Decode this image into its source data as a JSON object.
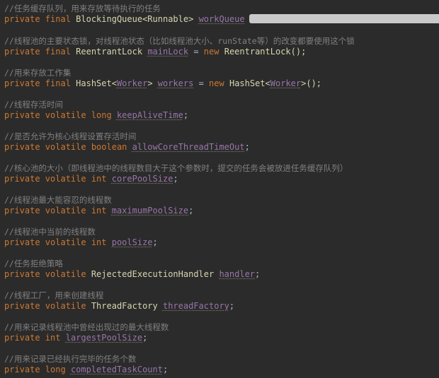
{
  "colors": {
    "background": "#2b2b2b",
    "comment": "#808080",
    "keyword": "#cc7832",
    "type": "#d6d6b0",
    "field": "#9876aa",
    "redaction": "#c9c9c9"
  },
  "blocks": [
    {
      "comment": "//任务缓存队列，用来存放等待执行的任务",
      "code": {
        "modifiers": "private final",
        "type": "BlockingQueue<Runnable>",
        "name": "workQueue",
        "tail": ""
      }
    },
    {
      "comment": "//线程池的主要状态锁，对线程池状态（比如线程池大小、runState等）的改变都要使用这个锁",
      "code": {
        "modifiers": "private final",
        "type": "ReentrantLock",
        "name": "mainLock",
        "eq": " = ",
        "new_kw": "new",
        "init": "ReentrantLock();"
      }
    },
    {
      "comment": "//用来存放工作集",
      "code": {
        "modifiers": "private final",
        "type_pre": "HashSet<",
        "type_generic": "Worker",
        "type_post": ">",
        "name": "workers",
        "eq": " = ",
        "new_kw": "new",
        "init_pre": "HashSet<",
        "init_generic": "Worker",
        "init_post": ">();"
      }
    },
    {
      "comment": "//线程存活时间",
      "code": {
        "modifiers": "private volatile long",
        "name": "keepAliveTime",
        "semi": ";"
      }
    },
    {
      "comment": "//是否允许为核心线程设置存活时间",
      "code": {
        "modifiers": "private volatile boolean",
        "name": "allowCoreThreadTimeOut",
        "semi": ";"
      }
    },
    {
      "comment": "//核心池的大小（即线程池中的线程数目大于这个参数时，提交的任务会被放进任务缓存队列）",
      "code": {
        "modifiers": "private volatile int",
        "name": "corePoolSize",
        "semi": ";"
      }
    },
    {
      "comment": "//线程池最大能容忍的线程数",
      "code": {
        "modifiers": "private volatile int",
        "name": "maximumPoolSize",
        "semi": ";"
      }
    },
    {
      "comment": "//线程池中当前的线程数",
      "code": {
        "modifiers": "private volatile int",
        "name": "poolSize",
        "semi": ";"
      }
    },
    {
      "comment": "//任务拒绝策略",
      "code": {
        "modifiers": "private volatile",
        "type": "RejectedExecutionHandler",
        "name": "handler",
        "semi": ";"
      }
    },
    {
      "comment": "//线程工厂，用来创建线程",
      "code": {
        "modifiers": "private volatile",
        "type": "ThreadFactory",
        "name": "threadFactory",
        "semi": ";"
      }
    },
    {
      "comment": "//用来记录线程池中曾经出现过的最大线程数",
      "code": {
        "modifiers": "private int",
        "name": "largestPoolSize",
        "semi": ";"
      }
    },
    {
      "comment": "//用来记录已经执行完毕的任务个数",
      "code": {
        "modifiers": "private long",
        "name": "completedTaskCount",
        "semi": ";"
      }
    }
  ]
}
